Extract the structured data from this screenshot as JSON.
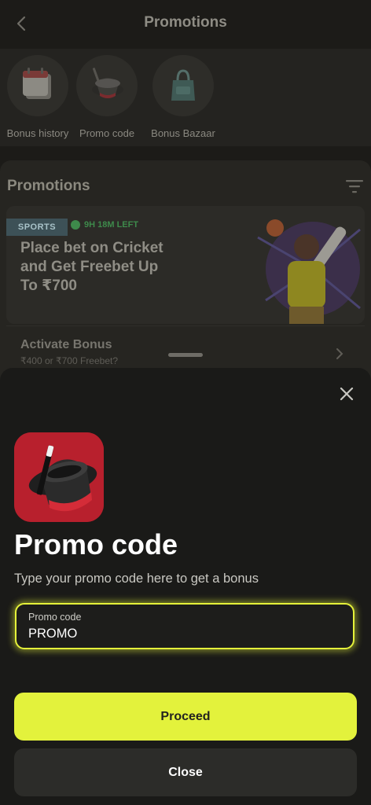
{
  "header": {
    "title": "Promotions"
  },
  "quick_links": [
    {
      "label": "Bonus history",
      "icon": "calendar-icon"
    },
    {
      "label": "Promo code",
      "icon": "magic-hat-icon"
    },
    {
      "label": "Bonus Bazaar",
      "icon": "shopping-bag-icon"
    }
  ],
  "promotions": {
    "heading": "Promotions",
    "card": {
      "tag": "SPORTS",
      "time_left": "9H 18M LEFT",
      "title": "Place bet on Cricket and Get Freebet Up To ₹700"
    },
    "activate": {
      "title": "Activate Bonus",
      "subtitle": "₹400 or ₹700 Freebet?"
    }
  },
  "sheet": {
    "title": "Promo code",
    "description": "Type your promo code here to get a bonus",
    "input": {
      "label": "Promo code",
      "value": "PROMO"
    },
    "proceed_label": "Proceed",
    "close_label": "Close"
  },
  "colors": {
    "accent": "#e3f23c",
    "logo_red": "#b8202d",
    "sports_tag": "#3d5157",
    "timer_green": "#3e8a4b"
  }
}
